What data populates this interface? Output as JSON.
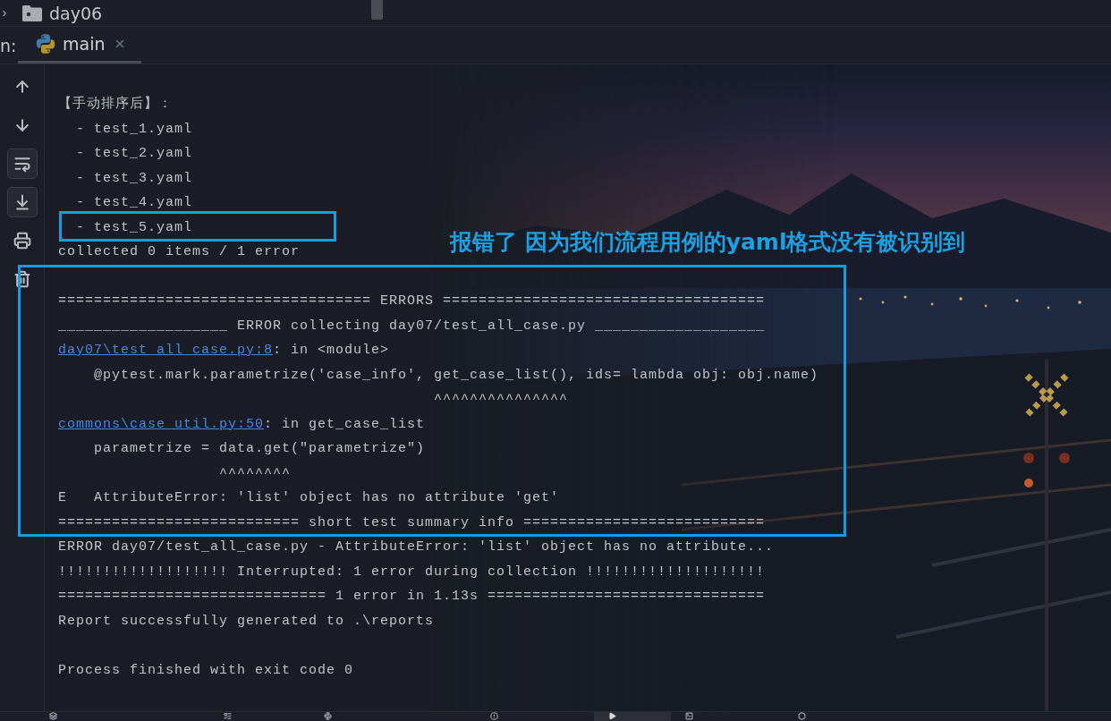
{
  "project_tree": {
    "items": [
      {
        "label": "day06",
        "expanded": false
      }
    ]
  },
  "run_panel": {
    "label": "n:",
    "tabs": [
      {
        "label": "main",
        "selected": true
      }
    ]
  },
  "toolbar": {
    "buttons": [
      {
        "kind": "up",
        "on": false
      },
      {
        "kind": "down",
        "on": false
      },
      {
        "kind": "soft_wrap",
        "on": true
      },
      {
        "kind": "scroll_to_end",
        "on": true
      },
      {
        "kind": "print",
        "on": false
      },
      {
        "kind": "delete",
        "on": false
      }
    ]
  },
  "console": {
    "lines": [
      {
        "kind": "text",
        "text": "【手动排序后】："
      },
      {
        "kind": "text",
        "text": "  - test_1.yaml"
      },
      {
        "kind": "text",
        "text": "  - test_2.yaml"
      },
      {
        "kind": "text",
        "text": "  - test_3.yaml"
      },
      {
        "kind": "text",
        "text": "  - test_4.yaml"
      },
      {
        "kind": "text",
        "text": "  - test_5.yaml"
      },
      {
        "kind": "text",
        "text": "collected 0 items / 1 error"
      },
      {
        "kind": "blank"
      },
      {
        "kind": "text",
        "text": "=================================== ERRORS ===================================="
      },
      {
        "kind": "text",
        "text": "___________________ ERROR collecting day07/test_all_case.py ___________________"
      },
      {
        "kind": "link",
        "link": "day07\\test_all_case.py:8",
        "text": ": in <module>"
      },
      {
        "kind": "text",
        "text": "    @pytest.mark.parametrize('case_info', get_case_list(), ids= lambda obj: obj.name)"
      },
      {
        "kind": "text",
        "text": "                                          ^^^^^^^^^^^^^^^"
      },
      {
        "kind": "link",
        "link": "commons\\case_util.py:50",
        "text": ": in get_case_list"
      },
      {
        "kind": "text",
        "text": "    parametrize = data.get(\"parametrize\")"
      },
      {
        "kind": "text",
        "text": "                  ^^^^^^^^"
      },
      {
        "kind": "text",
        "text": "E   AttributeError: 'list' object has no attribute 'get'"
      },
      {
        "kind": "text",
        "text": "=========================== short test summary info ==========================="
      },
      {
        "kind": "text",
        "text": "ERROR day07/test_all_case.py - AttributeError: 'list' object has no attribute..."
      },
      {
        "kind": "text",
        "text": "!!!!!!!!!!!!!!!!!!! Interrupted: 1 error during collection !!!!!!!!!!!!!!!!!!!!"
      },
      {
        "kind": "text",
        "text": "============================== 1 error in 1.13s ==============================="
      },
      {
        "kind": "text",
        "text": "Report successfully generated to .\\reports"
      },
      {
        "kind": "blank"
      },
      {
        "kind": "text",
        "text": "Process finished with exit code 0"
      }
    ]
  },
  "annotation": {
    "note": "报错了 因为我们流程用例的yaml格式没有被识别到"
  },
  "bottom_bar": {
    "tabs": [
      {
        "kind": "packages",
        "selected": false
      },
      {
        "kind": "todo",
        "selected": false
      },
      {
        "kind": "console",
        "selected": false
      },
      {
        "kind": "problems",
        "selected": false
      },
      {
        "kind": "run",
        "selected": true
      },
      {
        "kind": "terminal",
        "selected": false
      },
      {
        "kind": "services",
        "selected": false
      }
    ]
  }
}
